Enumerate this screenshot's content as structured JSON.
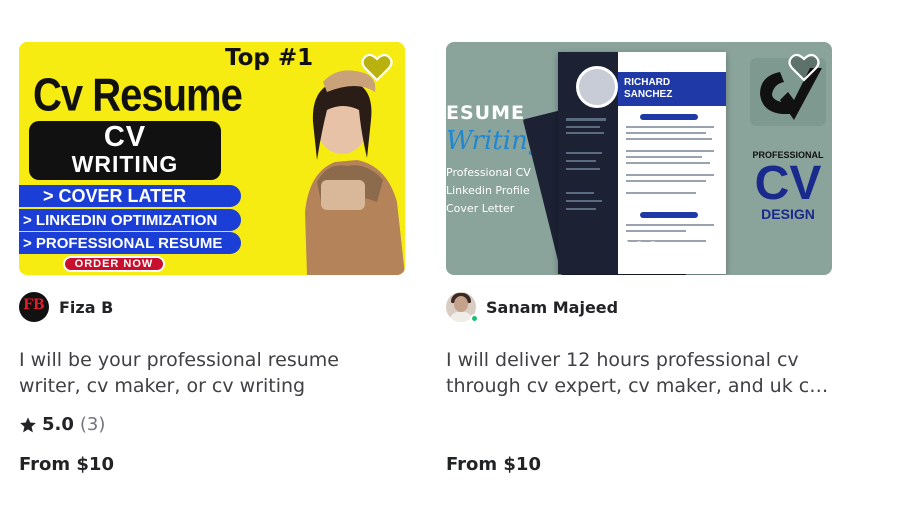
{
  "gigs": [
    {
      "thumbnail": {
        "top_badge": "Top #1",
        "headline": "Cv Resume",
        "box_line1": "CV",
        "box_line2": "WRITING",
        "bar1": "> COVER LATER",
        "bar2": "> LINKEDIN OPTIMIZATION",
        "bar3": "> PROFESSIONAL RESUME",
        "cta": "ORDER NOW"
      },
      "seller": {
        "name": "Fiza B",
        "avatar_text": "FB",
        "avatar_icon": "monogram-logo"
      },
      "title_line1": "I will be your professional resume",
      "title_line2": "writer, cv maker, or cv writing",
      "rating": {
        "value": "5.0",
        "count": "(3)"
      },
      "price": "From $10"
    },
    {
      "thumbnail": {
        "left_word1": "ESUME",
        "left_word2": "Writing",
        "left_lines": [
          "Professional CV",
          "Linkedin Profile",
          "Cover Letter"
        ],
        "doc_name_line1": "RICHARD",
        "doc_name_line2": "SANCHEZ",
        "pro_label": "PROFESSIONAL",
        "cv_label": "CV",
        "design_label": "DESIGN"
      },
      "seller": {
        "name": "Sanam Majeed",
        "online": true
      },
      "title_line1": "I will deliver 12 hours professional cv",
      "title_line2": "through cv expert, cv maker, and uk cv writing",
      "price": "From $10"
    }
  ],
  "colors": {
    "accent_yellow": "#f7ec12",
    "bar_blue": "#1b3fd6",
    "online_green": "#1dbf73",
    "text_dark": "#222325",
    "text_body": "#404145",
    "text_muted": "#74767e"
  }
}
